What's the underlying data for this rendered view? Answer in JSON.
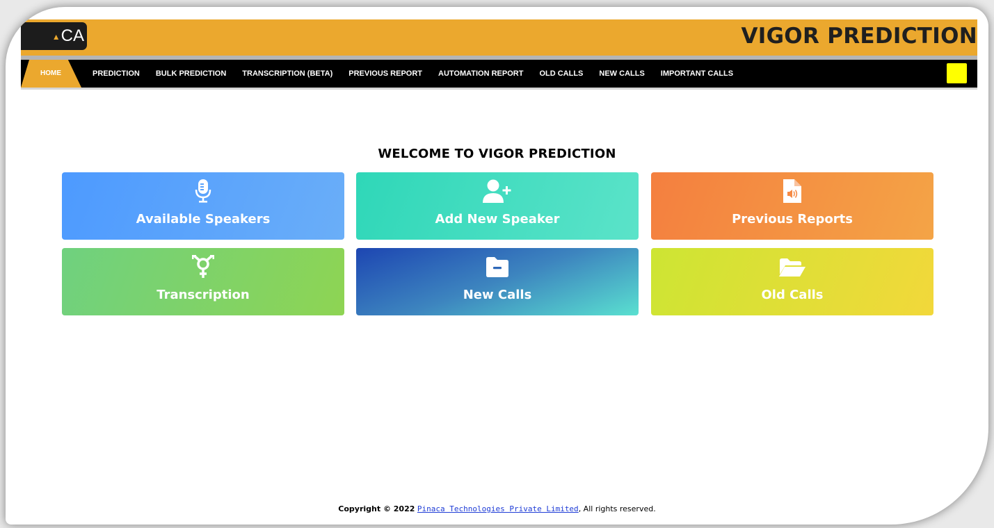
{
  "header": {
    "logo_text": "CA",
    "brand_title": "VIGOR PREDICTION"
  },
  "nav": {
    "items": [
      {
        "label": "HOME",
        "active": true
      },
      {
        "label": "PREDICTION"
      },
      {
        "label": "BULK PREDICTION"
      },
      {
        "label": "TRANSCRIPTION (BETA)"
      },
      {
        "label": "PREVIOUS REPORT"
      },
      {
        "label": "AUTOMATION REPORT"
      },
      {
        "label": "OLD CALLS"
      },
      {
        "label": "NEW CALLS"
      },
      {
        "label": "IMPORTANT CALLS"
      }
    ],
    "user_box_color": "#ffff00"
  },
  "main": {
    "welcome": "WELCOME TO VIGOR PREDICTION",
    "cards": [
      {
        "label": "Available Speakers",
        "icon": "microphone-icon"
      },
      {
        "label": "Add New Speaker",
        "icon": "user-plus-icon"
      },
      {
        "label": "Previous Reports",
        "icon": "audio-file-icon"
      },
      {
        "label": "Transcription",
        "icon": "transgender-icon"
      },
      {
        "label": "New Calls",
        "icon": "folder-minus-icon"
      },
      {
        "label": "Old Calls",
        "icon": "folder-open-icon"
      }
    ]
  },
  "footer": {
    "prefix": "Copyright © 2022",
    "company_link": "Pinaca Technologies Private Limited",
    "suffix": ", All rights reserved."
  },
  "colors": {
    "accent": "#eba82e",
    "nav_bg": "#000000"
  }
}
